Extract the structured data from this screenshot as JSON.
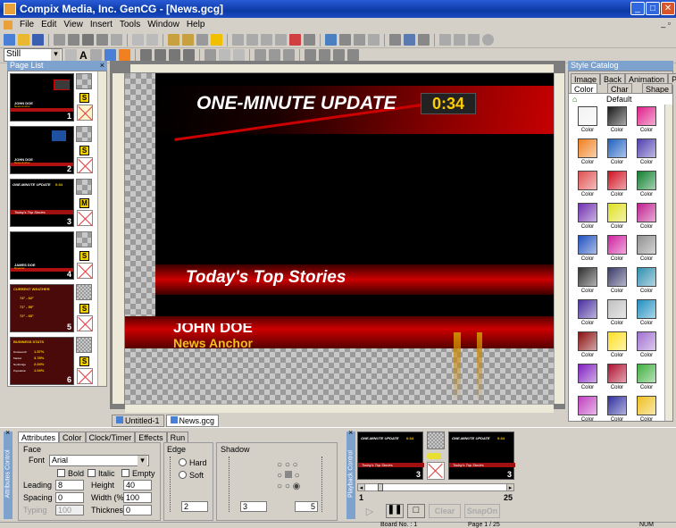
{
  "window": {
    "title": "Compix Media, Inc. GenCG - [News.gcg]"
  },
  "menu": [
    "File",
    "Edit",
    "View",
    "Insert",
    "Tools",
    "Window",
    "Help"
  ],
  "toolbar2": {
    "mode_select": "Still"
  },
  "page_list": {
    "header": "Page List",
    "pages": [
      {
        "number": "1",
        "badge": "S",
        "name_top": "JOHN DOE",
        "name_sub": "News Anchor"
      },
      {
        "number": "2",
        "badge": "S",
        "name_top": "JOHN DOE",
        "name_sub": "News Anchor"
      },
      {
        "number": "3",
        "badge": "M",
        "title": "ONE-MINUTE UPDATE",
        "time": "0:34",
        "banner": "Today's Top Stories"
      },
      {
        "number": "4",
        "badge": "S",
        "name_top": "JAMES DOE",
        "name_sub": "Reporter"
      },
      {
        "number": "5",
        "badge": "S",
        "header": "CURRENT WEATHER",
        "rows": [
          "74° - 62°",
          "71° - 59°",
          "72° - 60°"
        ]
      },
      {
        "number": "6",
        "badge": "S",
        "header": "BUSINESS STATS",
        "rows": [
          "1.57%",
          "3.78%",
          "2.04%",
          "1.04%"
        ],
        "labels": [
          "Dowsearch",
          "Market",
          "Northridge",
          "Population"
        ]
      }
    ]
  },
  "canvas": {
    "title": "ONE-MINUTE UPDATE",
    "time": "0:34",
    "banner": "Today's Top Stories",
    "lower_name": "JOHN DOE",
    "lower_title": "News Anchor"
  },
  "doc_tabs": [
    "Untitled-1",
    "News.gcg"
  ],
  "style_catalog": {
    "header": "Style Catalog",
    "tabs_row1": [
      "Image",
      "Back",
      "Animation",
      "Page"
    ],
    "tabs_row2": [
      "Color",
      "Char",
      "Shape"
    ],
    "default_label": "Default",
    "swatch_label": "Color",
    "swatches": [
      "#f2f2f2",
      "#1a1a1a",
      "#e0208a",
      "#f08020",
      "#2060c0",
      "#5040b0",
      "#e05050",
      "#d01020",
      "#108030",
      "#7030b0",
      "#e0e020",
      "#c02090",
      "#2050c0",
      "#d020a0",
      "#909090",
      "#303030",
      "#3a3a6a",
      "#3090b0",
      "#4a30a0",
      "#c0c0c0",
      "#2090c0",
      "#8a1010",
      "#ffe020",
      "#a070d0",
      "#8020c0",
      "#b01030",
      "#40b040",
      "#c040c0",
      "#3030a0",
      "#f0c020"
    ]
  },
  "attributes": {
    "side_label": "Attributes Control",
    "tabs": [
      "Attributes",
      "Color",
      "Clock/Timer",
      "Effects",
      "Run"
    ],
    "face_label": "Face",
    "font_label": "Font",
    "font_value": "Arial",
    "bold": "Bold",
    "italic": "Italic",
    "empty": "Empty",
    "leading_label": "Leading",
    "leading_value": "8",
    "height_label": "Height",
    "height_value": "40",
    "spacing_label": "Spacing",
    "spacing_value": "0",
    "width_label": "Width (%)",
    "width_value": "100",
    "typing_label": "Typing",
    "typing_value": "100",
    "thickness_label": "Thickness",
    "thickness_value": "0",
    "edge_label": "Edge",
    "hard_label": "Hard",
    "soft_label": "Soft",
    "edge_value": "2",
    "shadow_label": "Shadow",
    "shadow_value": "3",
    "shadow_value2": "5"
  },
  "playback": {
    "side_label": "Playback Control",
    "left_thumb": {
      "title": "ONE-MINUTE UPDATE",
      "time": "0:34",
      "banner": "Today's Top Stories",
      "number": "3"
    },
    "right_thumb": {
      "title": "ONE-MINUTE UPDATE",
      "time": "0:34",
      "banner": "Today's Top Stories",
      "number": "3"
    },
    "slider_min": "1",
    "slider_max": "25",
    "clear_label": "Clear",
    "snapon_label": "SnapOn"
  },
  "status": {
    "board": "Board No. : 1",
    "page": "Page 1 / 25",
    "num": "NUM"
  }
}
